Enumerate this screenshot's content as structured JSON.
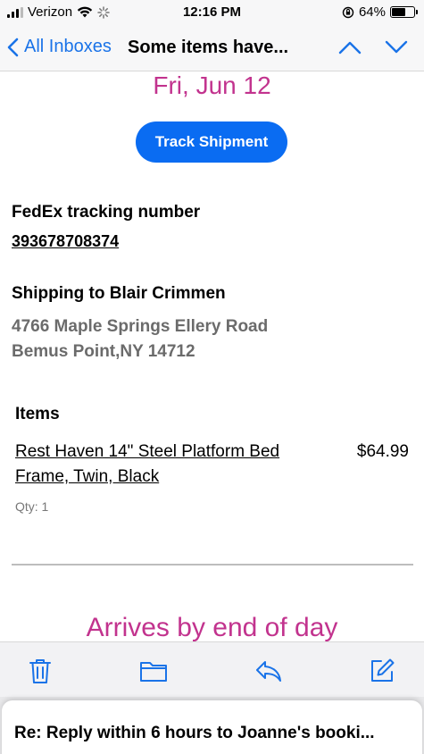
{
  "status_bar": {
    "carrier": "Verizon",
    "time": "12:16 PM",
    "battery_percent": "64%",
    "battery_level": 0.64
  },
  "nav": {
    "back_label": "All Inboxes",
    "title": "Some items have...",
    "accent_color": "#1a73e8"
  },
  "email": {
    "date": "Fri, Jun 12",
    "track_button": "Track Shipment",
    "tracking_label": "FedEx tracking number",
    "tracking_number": "393678708374",
    "shipping_label": "Shipping to Blair Crimmen",
    "address_line1": "4766 Maple Springs Ellery Road",
    "address_line2": "Bemus Point,NY 14712",
    "items_heading": "Items",
    "items": [
      {
        "name": "Rest Haven 14\" Steel Platform Bed Frame, Twin, Black",
        "price": "$64.99",
        "qty": "Qty: 1"
      }
    ],
    "arrives_text": "Arrives by end of day",
    "highlight_color": "#c2338e"
  },
  "toolbar": {
    "icons": [
      "trash-icon",
      "folder-icon",
      "reply-icon",
      "compose-icon"
    ]
  },
  "next_message": {
    "subject": "Re: Reply within 6 hours to Joanne's booki..."
  }
}
